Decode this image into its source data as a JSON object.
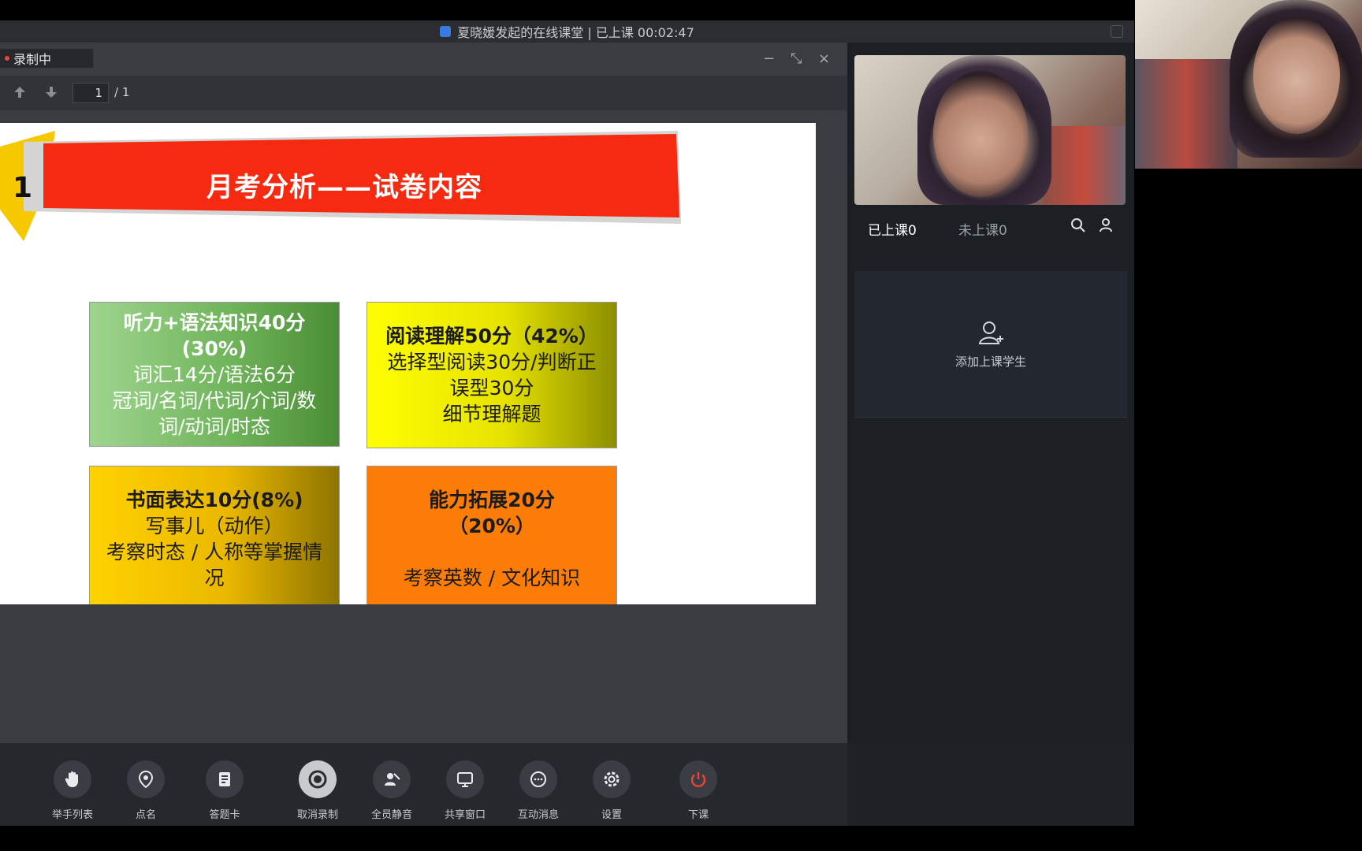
{
  "window": {
    "title": "夏晓媛发起的在线课堂 | 已上课 00:02:47"
  },
  "main": {
    "recording_label": "录制中",
    "controls": {
      "minimize": "−",
      "restore": "⤡",
      "close": "×"
    },
    "pager": {
      "current_page": "1",
      "total_pages": "/ 1"
    }
  },
  "slide": {
    "number": "1",
    "title": "月考分析——试卷内容",
    "boxes": [
      {
        "lines": [
          "听力+语法知识40分",
          "(30%)",
          "词汇14分/语法6分",
          "冠词/名词/代词/介词/数",
          "词/动词/时态"
        ]
      },
      {
        "lines": [
          "阅读理解50分（42%）",
          "选择型阅读30分/判断正",
          "误型30分",
          "细节理解题"
        ]
      },
      {
        "lines": [
          "书面表达10分(8%)",
          "写事儿（动作）",
          "考察时态 / 人称等掌握情",
          "况"
        ]
      },
      {
        "lines": [
          "能力拓展20分",
          "（20%）",
          "",
          "考察英数 / 文化知识"
        ]
      }
    ]
  },
  "sidebar": {
    "tab_attending": "已上课0",
    "tab_not_attending": "未上课0",
    "add_student_label": "添加上课学生"
  },
  "toolbar": {
    "items": [
      {
        "label": "举手列表",
        "icon": "hand-icon"
      },
      {
        "label": "点名",
        "icon": "location-icon"
      },
      {
        "label": "答题卡",
        "icon": "answer-card-icon"
      },
      {
        "label": "取消录制",
        "icon": "record-icon"
      },
      {
        "label": "全员静音",
        "icon": "mute-all-icon"
      },
      {
        "label": "共享窗口",
        "icon": "share-screen-icon"
      },
      {
        "label": "互动消息",
        "icon": "chat-icon"
      },
      {
        "label": "设置",
        "icon": "gear-icon"
      },
      {
        "label": "下课",
        "icon": "power-icon"
      }
    ]
  },
  "colors": {
    "banner_red": "#f52a10",
    "banner_yellow": "#f6c800",
    "power_red": "#e8452e"
  }
}
